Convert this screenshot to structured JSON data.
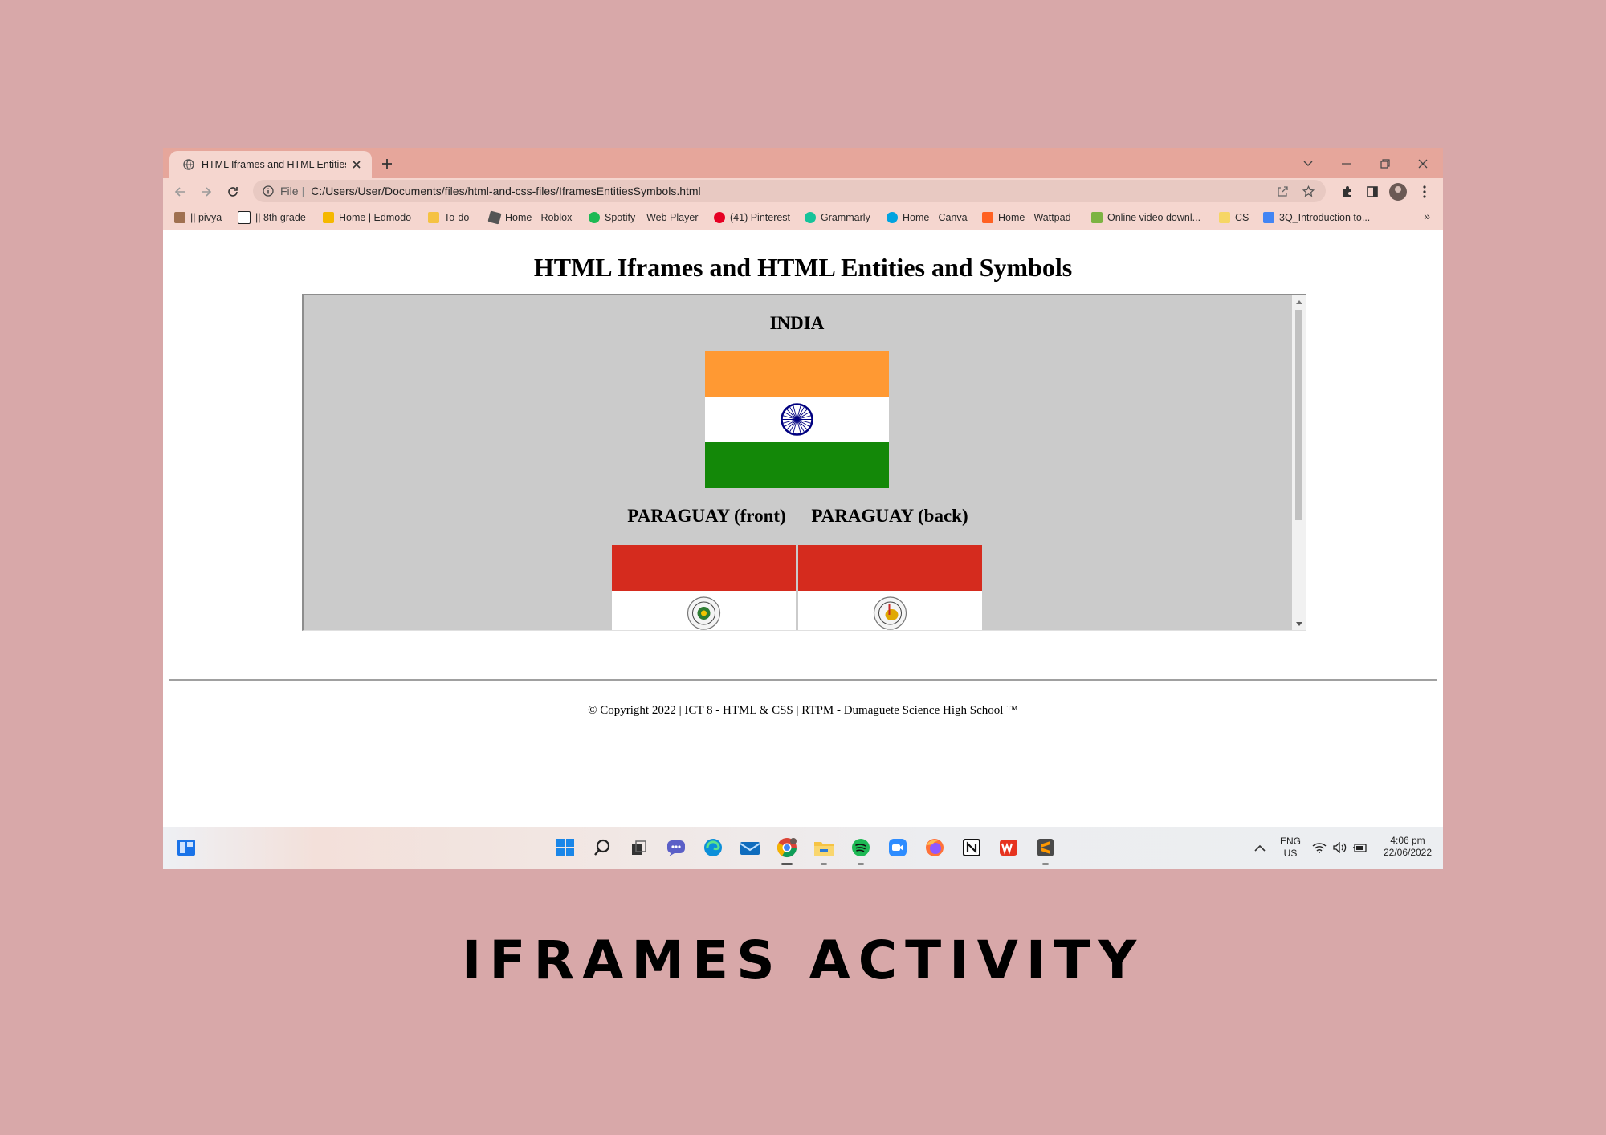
{
  "browser": {
    "tab": {
      "title": "HTML Iframes and HTML Entities",
      "close_icon": "close-icon"
    },
    "address": {
      "scheme": "File",
      "separator": "|",
      "url": "C:/Users/User/Documents/files/html-and-css-files/IframesEntitiesSymbols.html"
    },
    "bookmarks": [
      {
        "label": "|| pivya",
        "color": "#a07050"
      },
      {
        "label": "|| 8th grade",
        "color": "#222222"
      },
      {
        "label": "Home | Edmodo",
        "color": "#f5b800"
      },
      {
        "label": "To-do",
        "color": "#f5c242"
      },
      {
        "label": "Home - Roblox",
        "color": "#555555"
      },
      {
        "label": "Spotify – Web Player",
        "color": "#1db954"
      },
      {
        "label": "(41) Pinterest",
        "color": "#e60023"
      },
      {
        "label": "Grammarly",
        "color": "#15c39a"
      },
      {
        "label": "Home - Canva",
        "color": "#00a3e0"
      },
      {
        "label": "Home - Wattpad",
        "color": "#ff6122"
      },
      {
        "label": "Online video downl...",
        "color": "#7cb342"
      },
      {
        "label": "CS",
        "color": "#f6d664"
      },
      {
        "label": "3Q_Introduction to...",
        "color": "#4285f4"
      }
    ],
    "bookmarks_more": "»"
  },
  "page": {
    "title": "HTML Iframes and HTML Entities and Symbols",
    "iframe": {
      "heading_india": "INDIA",
      "heading_py_front": "PARAGUAY (front)",
      "heading_py_back": "PARAGUAY (back)"
    },
    "footer": "© Copyright 2022 | ICT 8 - HTML & CSS | RTPM - Dumaguete Science High School ™"
  },
  "taskbar": {
    "lang_top": "ENG",
    "lang_bottom": "US",
    "time": "4:06 pm",
    "date": "22/06/2022"
  },
  "caption": "IFRAMES ACTIVITY",
  "colors": {
    "background": "#d8a8a9",
    "tabstrip": "#e6a69b",
    "toolbar": "#f5d6cf",
    "india_saffron": "#ff9933",
    "india_green": "#138808",
    "chakra": "#000080",
    "paraguay_red": "#d52b1e"
  }
}
